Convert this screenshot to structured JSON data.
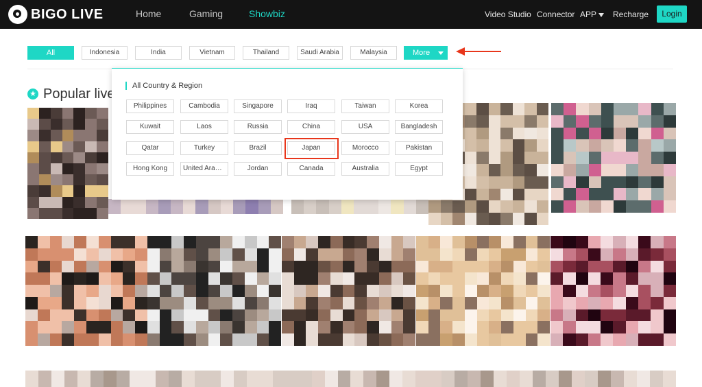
{
  "brand": {
    "name": "BIGO LIVE"
  },
  "nav": {
    "home": "Home",
    "gaming": "Gaming",
    "showbiz": "Showbiz"
  },
  "right_nav": {
    "video_studio": "Video Studio",
    "connector": "Connector",
    "app": "APP",
    "recharge": "Recharge",
    "login": "Login"
  },
  "filters": [
    "All",
    "Indonesia",
    "India",
    "Vietnam",
    "Thailand",
    "Saudi Arabia",
    "Malaysia"
  ],
  "more_label": "More",
  "section_title": "Popular live",
  "dropdown": {
    "title": "All Country & Region",
    "countries": [
      [
        "Philippines",
        "Cambodia",
        "Singapore",
        "Iraq",
        "Taiwan",
        "Korea"
      ],
      [
        "Kuwait",
        "Laos",
        "Russia",
        "China",
        "USA",
        "Bangladesh"
      ],
      [
        "Qatar",
        "Turkey",
        "Brazil",
        "Japan",
        "Morocco",
        "Pakistan"
      ],
      [
        "Hong Kong",
        "United Arab ...",
        "Jordan",
        "Canada",
        "Australia",
        "Egypt"
      ]
    ],
    "highlighted": "Japan"
  },
  "colors": {
    "accent": "#1ed7c5",
    "annotation": "#e8361b",
    "topbar": "#141414"
  },
  "icons": {
    "logo": "bigo-logo-icon",
    "caret": "caret-down-icon",
    "star": "star-icon",
    "arrow": "annotation-arrow-icon"
  }
}
